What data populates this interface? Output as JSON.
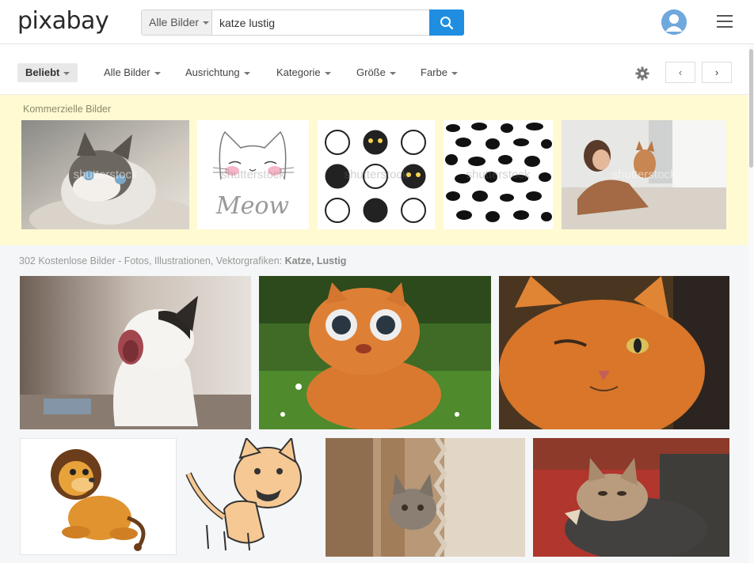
{
  "header": {
    "logo": "pixabay",
    "search_type": "Alle Bilder",
    "search_value": "katze lustig"
  },
  "filters": {
    "popular": "Beliebt",
    "all_images": "Alle Bilder",
    "orientation": "Ausrichtung",
    "category": "Kategorie",
    "size": "Größe",
    "color": "Farbe",
    "prev": "‹",
    "next": "›"
  },
  "commercial": {
    "label": "Kommerzielle Bilder",
    "watermark": "shutterstock",
    "meow_text": "Meow"
  },
  "results": {
    "prefix": "302 Kostenlose Bilder - Fotos, Illustrationen, Vektorgrafiken: ",
    "query": "Katze, Lustig"
  },
  "icons": {
    "search": "search-icon",
    "user": "user-icon",
    "menu": "menu-icon",
    "settings": "gear-icon"
  },
  "colors": {
    "accent": "#1f8ee0",
    "commercial_bg": "#fffad2"
  }
}
